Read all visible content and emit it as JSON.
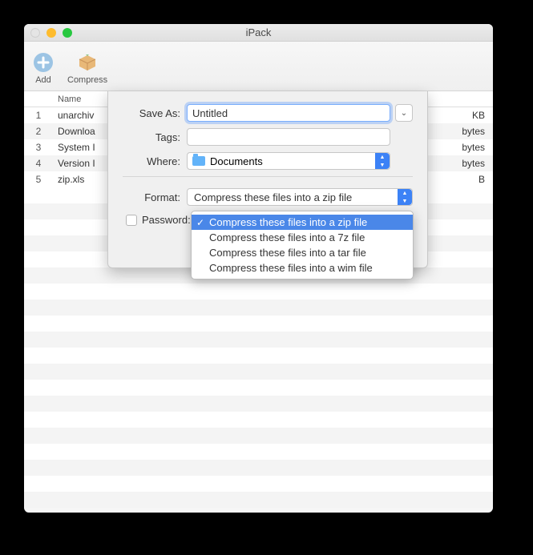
{
  "window": {
    "title": "iPack"
  },
  "toolbar": {
    "add": "Add",
    "compress": "Compress"
  },
  "table": {
    "header": {
      "name": "Name"
    },
    "rows": [
      {
        "idx": "1",
        "name": "unarchiv",
        "size": "KB"
      },
      {
        "idx": "2",
        "name": "Downloa",
        "size": "bytes"
      },
      {
        "idx": "3",
        "name": "System I",
        "size": "bytes"
      },
      {
        "idx": "4",
        "name": "Version I",
        "size": "bytes"
      },
      {
        "idx": "5",
        "name": "zip.xls",
        "size": "B"
      }
    ]
  },
  "sheet": {
    "save_as_label": "Save As:",
    "save_as_value": "Untitled",
    "tags_label": "Tags:",
    "tags_value": "",
    "where_label": "Where:",
    "where_value": "Documents",
    "format_label": "Format:",
    "format_value": "Compress these files into a zip file",
    "password_label": "Password:"
  },
  "dropdown": {
    "items": [
      "Compress these files into a zip file",
      "Compress these files into a 7z file",
      "Compress these files into a tar file",
      "Compress these files into a wim file"
    ],
    "selected_index": 0
  }
}
